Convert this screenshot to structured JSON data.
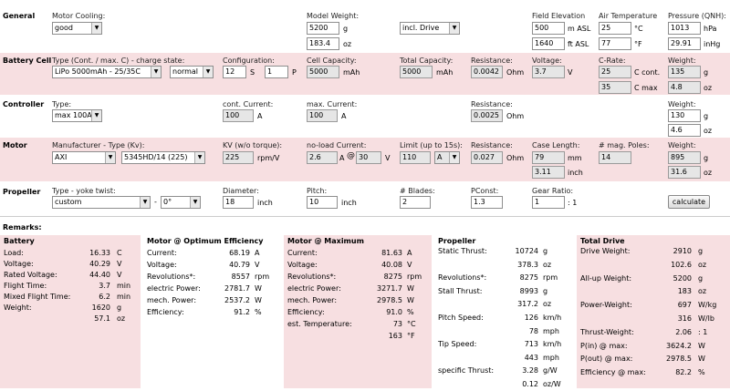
{
  "general": {
    "section": "General",
    "motor_cooling_label": "Motor Cooling:",
    "motor_cooling_value": "good",
    "model_weight_label": "Model Weight:",
    "model_weight_g": "5200",
    "model_weight_g_unit": "g",
    "model_weight_oz": "183.4",
    "model_weight_oz_unit": "oz",
    "drive_select": "incl. Drive",
    "field_elev_label": "Field Elevation",
    "field_elev_m": "500",
    "field_elev_m_unit": "m ASL",
    "field_elev_ft": "1640",
    "field_elev_ft_unit": "ft ASL",
    "air_temp_label": "Air Temperature",
    "air_temp_c": "25",
    "air_temp_c_unit": "°C",
    "air_temp_f": "77",
    "air_temp_f_unit": "°F",
    "pressure_label": "Pressure (QNH):",
    "pressure_hpa": "1013",
    "pressure_hpa_unit": "hPa",
    "pressure_inhg": "29.91",
    "pressure_inhg_unit": "inHg"
  },
  "battery": {
    "section": "Battery Cell",
    "type_label": "Type (Cont. / max. C) - charge state:",
    "type_value": "LiPo 5000mAh - 25/35C",
    "charge_value": "normal",
    "config_label": "Configuration:",
    "config_s": "12",
    "config_s_unit": "S",
    "config_p": "1",
    "config_p_unit": "P",
    "cell_cap_label": "Cell Capacity:",
    "cell_cap": "5000",
    "cell_cap_unit": "mAh",
    "total_cap_label": "Total Capacity:",
    "total_cap": "5000",
    "total_cap_unit": "mAh",
    "resistance_label": "Resistance:",
    "resistance": "0.0042",
    "resistance_unit": "Ohm",
    "voltage_label": "Voltage:",
    "voltage": "3.7",
    "voltage_unit": "V",
    "crate_label": "C-Rate:",
    "crate_cont": "25",
    "crate_cont_unit": "C cont.",
    "crate_max": "35",
    "crate_max_unit": "C max",
    "weight_label": "Weight:",
    "weight_g": "135",
    "weight_g_unit": "g",
    "weight_oz": "4.8",
    "weight_oz_unit": "oz"
  },
  "controller": {
    "section": "Controller",
    "type_label": "Type:",
    "type_value": "max 100A",
    "cont_label": "cont. Current:",
    "cont": "100",
    "cont_unit": "A",
    "max_label": "max. Current:",
    "max": "100",
    "max_unit": "A",
    "resistance_label": "Resistance:",
    "resistance": "0.0025",
    "resistance_unit": "Ohm",
    "weight_label": "Weight:",
    "weight_g": "130",
    "weight_g_unit": "g",
    "weight_oz": "4.6",
    "weight_oz_unit": "oz"
  },
  "motor": {
    "section": "Motor",
    "mfr_label": "Manufacturer - Type (Kv):",
    "mfr_value": "AXI",
    "type_value": "5345HD/14 (225)",
    "kv_label": "KV (w/o torque):",
    "kv": "225",
    "kv_unit": "rpm/V",
    "noload_label": "no-load Current:",
    "noload_a": "2.6",
    "noload_a_unit": "A",
    "at": "@",
    "noload_v": "30",
    "noload_v_unit": "V",
    "limit_label": "Limit (up to 15s):",
    "limit": "110",
    "limit_unit": "A",
    "resistance_label": "Resistance:",
    "resistance": "0.027",
    "resistance_unit": "Ohm",
    "case_label": "Case Length:",
    "case_mm": "79",
    "case_mm_unit": "mm",
    "case_in": "3.11",
    "case_in_unit": "inch",
    "poles_label": "# mag. Poles:",
    "poles": "14",
    "weight_label": "Weight:",
    "weight_g": "895",
    "weight_g_unit": "g",
    "weight_oz": "31.6",
    "weight_oz_unit": "oz"
  },
  "propeller": {
    "section": "Propeller",
    "type_label": "Type - yoke twist:",
    "type_value": "custom",
    "dash": "-",
    "twist_value": "0°",
    "diameter_label": "Diameter:",
    "diameter": "18",
    "diameter_unit": "inch",
    "pitch_label": "Pitch:",
    "pitch": "10",
    "pitch_unit": "inch",
    "blades_label": "# Blades:",
    "blades": "2",
    "pconst_label": "PConst:",
    "pconst": "1.3",
    "gear_label": "Gear Ratio:",
    "gear": "1",
    "gear_unit": ": 1",
    "calc_button": "calculate"
  },
  "remarks": {
    "label": "Remarks:"
  },
  "results": {
    "battery": {
      "title": "Battery",
      "rows": [
        {
          "k": "Load:",
          "v": "16.33",
          "u": "C"
        },
        {
          "k": "Voltage:",
          "v": "40.29",
          "u": "V"
        },
        {
          "k": "Rated Voltage:",
          "v": "44.40",
          "u": "V"
        },
        {
          "k": "Flight Time:",
          "v": "3.7",
          "u": "min"
        },
        {
          "k": "Mixed Flight Time:",
          "v": "6.2",
          "u": "min"
        },
        {
          "k": "Weight:",
          "v": "1620",
          "u": "g"
        },
        {
          "k": "",
          "v": "57.1",
          "u": "oz"
        }
      ]
    },
    "optimum": {
      "title": "Motor @ Optimum Efficiency",
      "rows": [
        {
          "k": "Current:",
          "v": "68.19",
          "u": "A"
        },
        {
          "k": "Voltage:",
          "v": "40.79",
          "u": "V"
        },
        {
          "k": "Revolutions*:",
          "v": "8557",
          "u": "rpm"
        },
        {
          "k": "electric Power:",
          "v": "2781.7",
          "u": "W"
        },
        {
          "k": "mech. Power:",
          "v": "2537.2",
          "u": "W"
        },
        {
          "k": "Efficiency:",
          "v": "91.2",
          "u": "%"
        }
      ]
    },
    "maximum": {
      "title": "Motor @ Maximum",
      "rows": [
        {
          "k": "Current:",
          "v": "81.63",
          "u": "A"
        },
        {
          "k": "Voltage:",
          "v": "40.08",
          "u": "V"
        },
        {
          "k": "Revolutions*:",
          "v": "8275",
          "u": "rpm"
        },
        {
          "k": "electric Power:",
          "v": "3271.7",
          "u": "W"
        },
        {
          "k": "mech. Power:",
          "v": "2978.5",
          "u": "W"
        },
        {
          "k": "Efficiency:",
          "v": "91.0",
          "u": "%"
        },
        {
          "k": "est. Temperature:",
          "v": "73",
          "u": "°C"
        },
        {
          "k": "",
          "v": "163",
          "u": "°F"
        }
      ]
    },
    "propeller": {
      "title": "Propeller",
      "rows": [
        {
          "k": "Static Thrust:",
          "v": "10724",
          "u": "g"
        },
        {
          "k": "",
          "v": "378.3",
          "u": "oz"
        },
        {
          "k": "Revolutions*:",
          "v": "8275",
          "u": "rpm"
        },
        {
          "k": "Stall Thrust:",
          "v": "8993",
          "u": "g"
        },
        {
          "k": "",
          "v": "317.2",
          "u": "oz"
        },
        {
          "k": "Pitch Speed:",
          "v": "126",
          "u": "km/h"
        },
        {
          "k": "",
          "v": "78",
          "u": "mph"
        },
        {
          "k": "Tip Speed:",
          "v": "713",
          "u": "km/h"
        },
        {
          "k": "",
          "v": "443",
          "u": "mph"
        },
        {
          "k": "specific Thrust:",
          "v": "3.28",
          "u": "g/W"
        },
        {
          "k": "",
          "v": "0.12",
          "u": "oz/W"
        }
      ]
    },
    "total": {
      "title": "Total Drive",
      "rows": [
        {
          "k": "Drive Weight:",
          "v": "2910",
          "u": "g"
        },
        {
          "k": "",
          "v": "102.6",
          "u": "oz"
        },
        {
          "k": "All-up Weight:",
          "v": "5200",
          "u": "g"
        },
        {
          "k": "",
          "v": "183",
          "u": "oz"
        },
        {
          "k": "Power-Weight:",
          "v": "697",
          "u": "W/kg"
        },
        {
          "k": "",
          "v": "316",
          "u": "W/lb"
        },
        {
          "k": "Thrust-Weight:",
          "v": "2.06",
          "u": ": 1"
        },
        {
          "k": "P(in) @ max:",
          "v": "3624.2",
          "u": "W"
        },
        {
          "k": "P(out) @ max:",
          "v": "2978.5",
          "u": "W"
        },
        {
          "k": "Efficiency @ max:",
          "v": "82.2",
          "u": "%"
        }
      ]
    }
  }
}
